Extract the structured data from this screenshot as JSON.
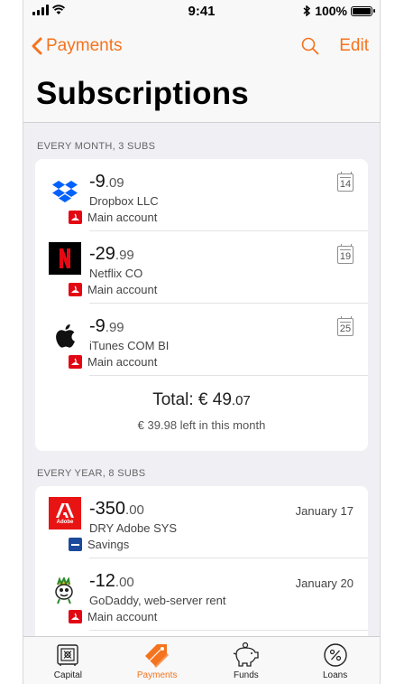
{
  "status_bar": {
    "time": "9:41",
    "battery": "100%"
  },
  "nav": {
    "back_label": "Payments",
    "edit_label": "Edit",
    "title": "Subscriptions"
  },
  "monthly": {
    "header": "EVERY MONTH, 3 SUBS",
    "items": [
      {
        "amount_main": "-9",
        "amount_cents": ".09",
        "merchant": "Dropbox LLC",
        "account": "Main account",
        "day": "14",
        "logo": "dropbox-logo"
      },
      {
        "amount_main": "-29",
        "amount_cents": ".99",
        "merchant": "Netflix CO",
        "account": "Main account",
        "day": "19",
        "logo": "netflix-logo"
      },
      {
        "amount_main": "-9",
        "amount_cents": ".99",
        "merchant": "iTunes COM BI",
        "account": "Main account",
        "day": "25",
        "logo": "apple-logo"
      }
    ],
    "total_prefix": "Total: € 49",
    "total_cents": ".07",
    "left_text": "€ 39.98 left in this month"
  },
  "yearly": {
    "header": "EVERY YEAR, 8 SUBS",
    "items": [
      {
        "amount_main": "-350",
        "amount_cents": ".00",
        "merchant": "DRY Adobe SYS",
        "account": "Savings",
        "date": "January 17",
        "logo": "adobe-logo",
        "logo_text": "Adobe"
      },
      {
        "amount_main": "-12",
        "amount_cents": ".00",
        "merchant": "GoDaddy, web-server rent",
        "account": "Main account",
        "date": "January 20",
        "logo": "godaddy-logo"
      }
    ]
  },
  "tabs": [
    {
      "label": "Capital",
      "icon": "safe-icon"
    },
    {
      "label": "Payments",
      "icon": "tag-icon"
    },
    {
      "label": "Funds",
      "icon": "piggy-bank-icon"
    },
    {
      "label": "Loans",
      "icon": "percent-icon"
    }
  ],
  "colors": {
    "accent": "#f5731e",
    "santander_red": "#e30613",
    "savings_blue": "#1b4a9c",
    "background": "#efeff4"
  }
}
